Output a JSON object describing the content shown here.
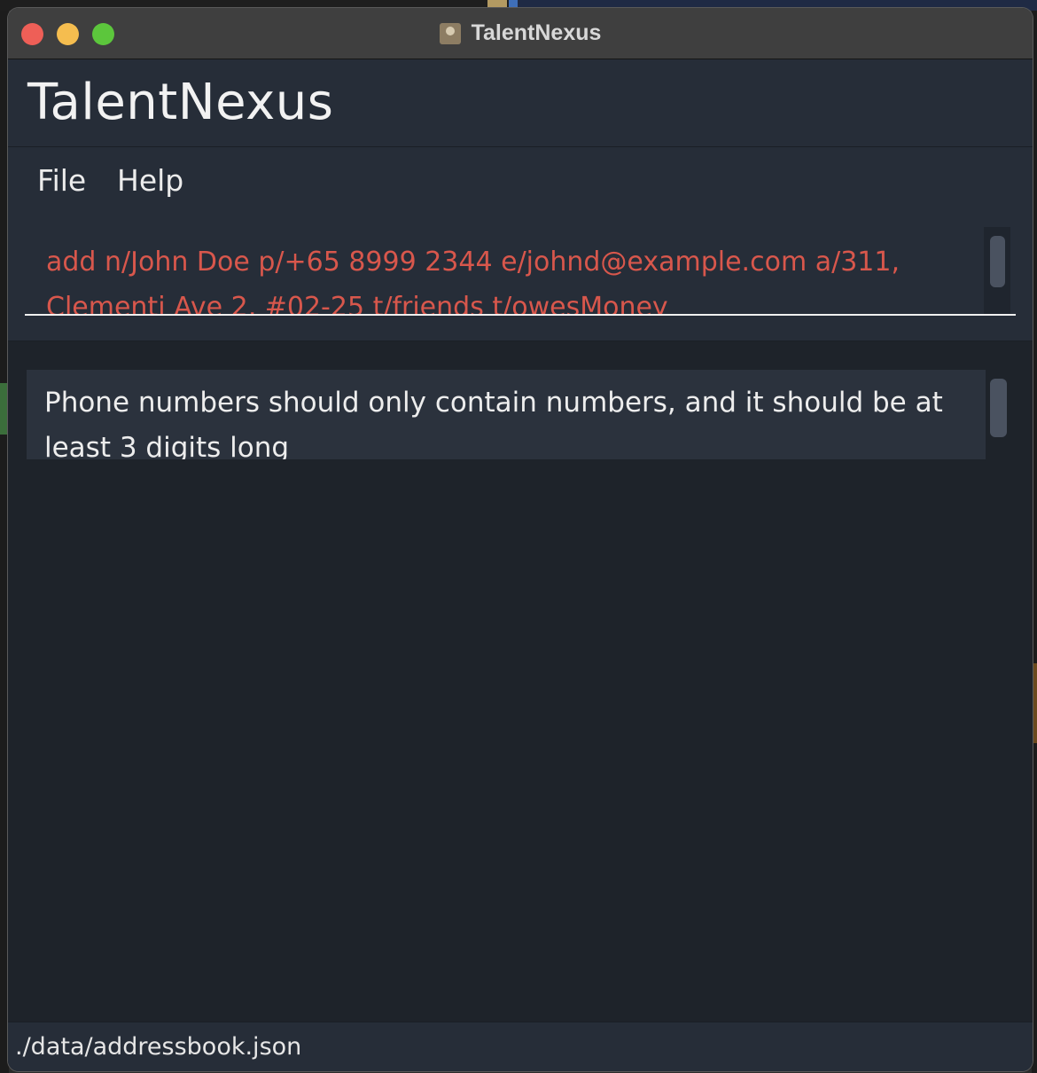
{
  "window": {
    "title": "TalentNexus"
  },
  "app": {
    "name": "TalentNexus"
  },
  "menu": {
    "items": [
      {
        "label": "File"
      },
      {
        "label": "Help"
      }
    ]
  },
  "command": {
    "value": "add n/John Doe p/+65 8999 2344 e/johnd@example.com a/311, Clementi Ave 2, #02-25 t/friends t/owesMoney",
    "text_color": "#d8574c"
  },
  "result": {
    "message": "Phone numbers should only contain numbers, and it should be at least 3 digits long"
  },
  "status": {
    "save_location": "./data/addressbook.json"
  },
  "colors": {
    "background": "#1e232a",
    "panel": "#262d38",
    "error_text": "#d8574c"
  }
}
